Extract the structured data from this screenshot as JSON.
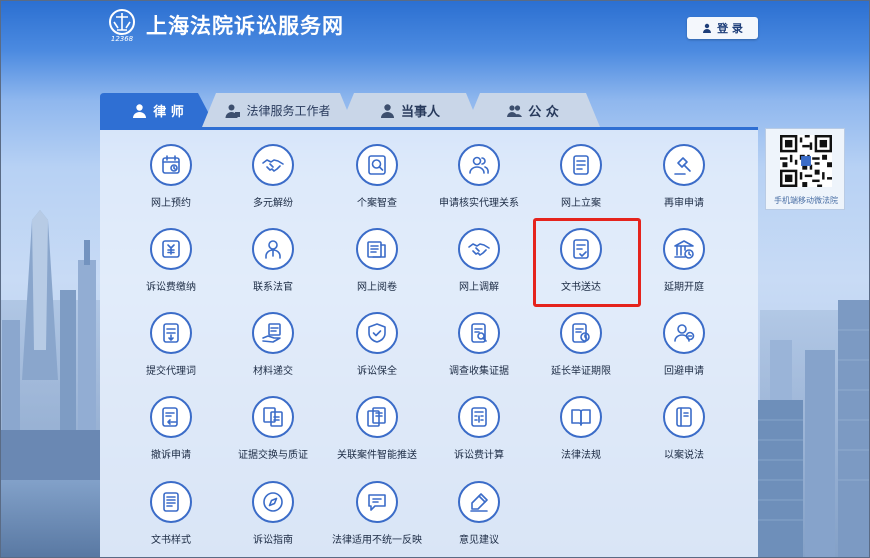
{
  "header": {
    "site_title": "上海法院诉讼服务网",
    "logo_subtext": "12368",
    "login_label": "登 录"
  },
  "tabs": [
    {
      "label": "律 师",
      "icon": "user-icon",
      "active": true
    },
    {
      "label": "法律服务工作者",
      "icon": "user-badge-icon",
      "active": false
    },
    {
      "label": "当事人",
      "icon": "user-icon",
      "active": false
    },
    {
      "label": "公 众",
      "icon": "group-icon",
      "active": false
    }
  ],
  "services": [
    {
      "label": "网上预约",
      "icon": "calendar-icon"
    },
    {
      "label": "多元解纷",
      "icon": "handshake-icon"
    },
    {
      "label": "个案智查",
      "icon": "search-doc-icon"
    },
    {
      "label": "申请核实代理关系",
      "icon": "users-icon"
    },
    {
      "label": "网上立案",
      "icon": "document-icon"
    },
    {
      "label": "再审申请",
      "icon": "gavel-icon"
    },
    {
      "label": "诉讼费缴纳",
      "icon": "fee-icon"
    },
    {
      "label": "联系法官",
      "icon": "judge-icon"
    },
    {
      "label": "网上阅卷",
      "icon": "read-file-icon"
    },
    {
      "label": "网上调解",
      "icon": "handshake-icon"
    },
    {
      "label": "文书送达",
      "icon": "document-check-icon"
    },
    {
      "label": "延期开庭",
      "icon": "courthouse-clock-icon"
    },
    {
      "label": "提交代理词",
      "icon": "submit-doc-icon"
    },
    {
      "label": "材料递交",
      "icon": "hand-doc-icon"
    },
    {
      "label": "诉讼保全",
      "icon": "shield-check-icon"
    },
    {
      "label": "调查收集证据",
      "icon": "doc-search-icon"
    },
    {
      "label": "延长举证期限",
      "icon": "doc-clock-icon"
    },
    {
      "label": "回避申请",
      "icon": "user-minus-icon"
    },
    {
      "label": "撤诉申请",
      "icon": "doc-return-icon"
    },
    {
      "label": "证据交换与质证",
      "icon": "exchange-docs-icon"
    },
    {
      "label": "关联案件智能推送",
      "icon": "linked-docs-icon"
    },
    {
      "label": "诉讼费计算",
      "icon": "calculator-icon"
    },
    {
      "label": "法律法规",
      "icon": "book-icon"
    },
    {
      "label": "以案说法",
      "icon": "case-book-icon"
    },
    {
      "label": "文书样式",
      "icon": "template-doc-icon"
    },
    {
      "label": "诉讼指南",
      "icon": "compass-icon"
    },
    {
      "label": "法律适用不统一反映",
      "icon": "feedback-icon"
    },
    {
      "label": "意见建议",
      "icon": "pen-icon"
    }
  ],
  "qr": {
    "caption": "手机端移动微法院"
  },
  "colors": {
    "accent": "#2f6fd3",
    "highlight": "#e5231c",
    "icon_stroke": "#3b6cc8"
  }
}
